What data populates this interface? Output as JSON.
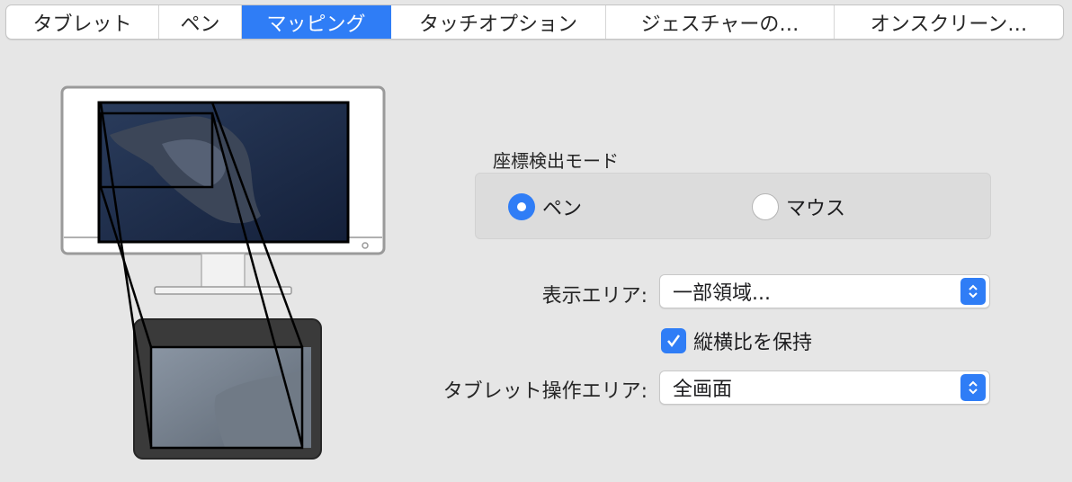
{
  "tabs": [
    {
      "label": "タブレット",
      "active": false
    },
    {
      "label": "ペン",
      "active": false
    },
    {
      "label": "マッピング",
      "active": true
    },
    {
      "label": "タッチオプション",
      "active": false
    },
    {
      "label": "ジェスチャーの…",
      "active": false
    },
    {
      "label": "オンスクリーン…",
      "active": false
    }
  ],
  "mapping": {
    "mode_title": "座標検出モード",
    "mode_options": [
      {
        "label": "ペン",
        "selected": true
      },
      {
        "label": "マウス",
        "selected": false
      }
    ],
    "display_area": {
      "label": "表示エリア:",
      "value": "一部領域..."
    },
    "keep_aspect": {
      "label": "縦横比を保持",
      "checked": true
    },
    "tablet_area": {
      "label": "タブレット操作エリア:",
      "value": "全画面"
    }
  },
  "colors": {
    "accent": "#2f7df6",
    "background": "#e6e6e6",
    "wallpaper_dark": "#1b2a44",
    "tablet_body": "#3a3a3a"
  },
  "icons": {
    "monitor": "monitor-icon",
    "tablet": "tablet-icon",
    "stepper": "chevron-up-down-icon",
    "check": "checkmark-icon"
  }
}
